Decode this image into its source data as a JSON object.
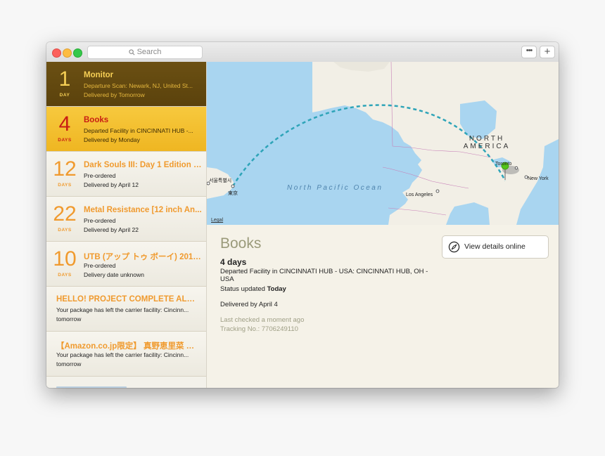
{
  "titlebar": {
    "search_placeholder": "Search",
    "more_label": "•••",
    "add_label": "+"
  },
  "packages": [
    {
      "number": "1",
      "unit": "DAY",
      "title": "Monitor",
      "line2": "Departure Scan: Newark, NJ, United St...",
      "line3": "Delivered by Tomorrow",
      "style": "brown"
    },
    {
      "number": "4",
      "unit": "DAYS",
      "title": "Books",
      "line2": "Departed Facility in CINCINNATI HUB -...",
      "line3": "Delivered by Monday",
      "style": "gold"
    },
    {
      "number": "12",
      "unit": "DAYS",
      "title": "Dark Souls III: Day 1 Edition -...",
      "line2": "Pre-ordered",
      "line3": "Delivered by April 12",
      "style": "light"
    },
    {
      "number": "22",
      "unit": "DAYS",
      "title": "Metal Resistance [12 inch An...",
      "line2": "Pre-ordered",
      "line3": "Delivered by April 22",
      "style": "light"
    },
    {
      "number": "10",
      "unit": "DAYS",
      "title": "UTB (アップ トゥ ボーイ) 2016···",
      "line2": "Pre-ordered",
      "line3": "Delivery date unknown",
      "style": "light"
    },
    {
      "title": "HELLO! PROJECT COMPLETE ALBU...",
      "line2": "Your package has left the carrier facility: Cincinn...",
      "line3": "tomorrow",
      "style": "light-wide"
    },
    {
      "title": "【Amazon.co.jp限定】 真野恵里菜 スケ···",
      "line2": "Your package has left the carrier facility: Cincinn...",
      "line3": "tomorrow",
      "style": "light-wide"
    }
  ],
  "map": {
    "legal": "Legal",
    "ocean_label": "North Pacific Ocean",
    "continent_line1": "NORTH",
    "continent_line2": "AMERICA",
    "cities": {
      "seoul": "서울특별시",
      "tokyo": "東京",
      "los_angeles": "Los Angeles",
      "new_york": "New York",
      "toronto": "Toronto"
    },
    "colors": {
      "water": "#a9d5f0",
      "land": "#f2efe6",
      "route": "#2ea4b8",
      "pin": "#52c41a"
    }
  },
  "detail": {
    "title": "Books",
    "days": "4 days",
    "status": "Departed Facility in CINCINNATI HUB - USA: CINCINNATI HUB, OH - USA",
    "updated_prefix": "Status updated ",
    "updated_value": "Today",
    "delivery": "Delivered by April 4",
    "last_checked": "Last checked a moment ago",
    "tracking": "Tracking No.: 7706249110",
    "view_button": "View details online"
  }
}
